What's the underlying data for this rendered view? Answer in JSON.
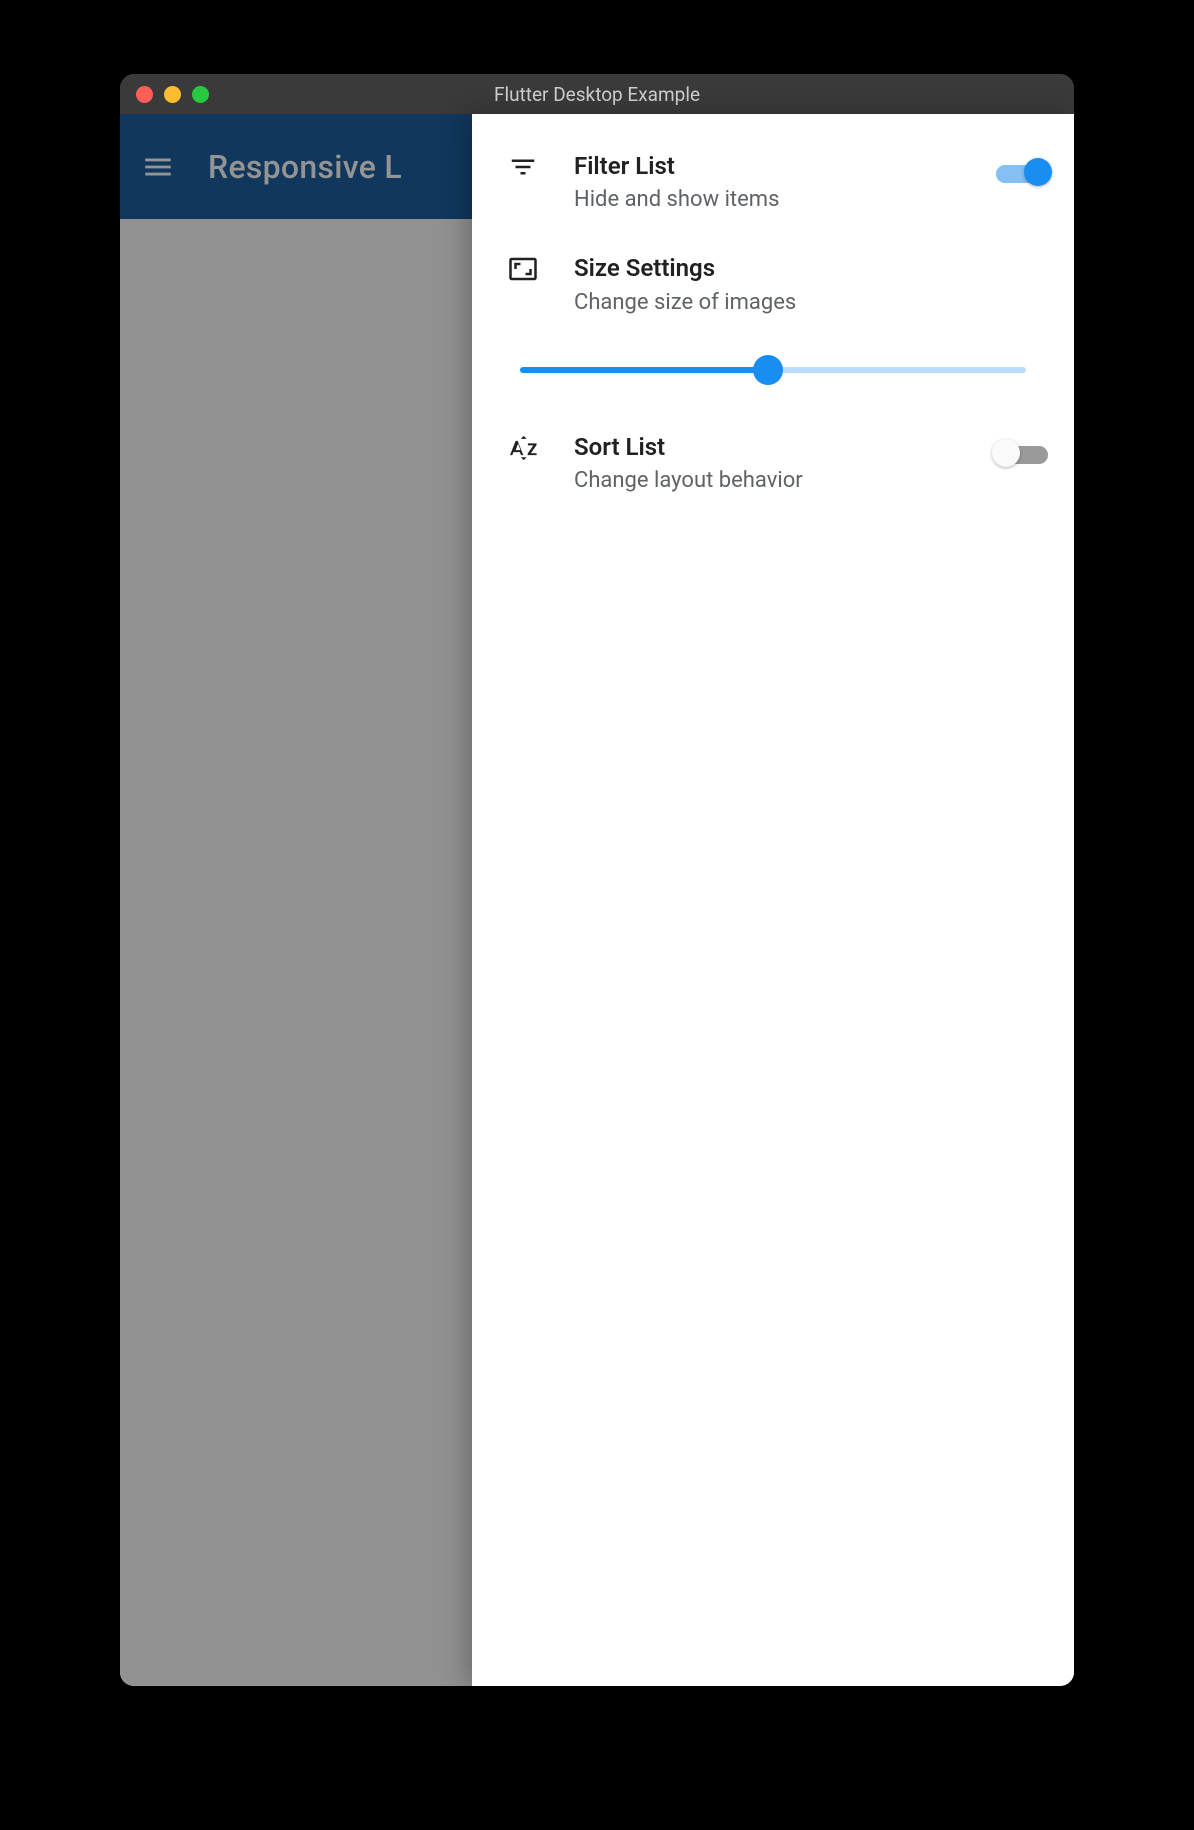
{
  "window": {
    "title": "Flutter Desktop Example"
  },
  "appbar": {
    "title": "Responsive L"
  },
  "drawer": {
    "filter": {
      "title": "Filter List",
      "subtitle": "Hide and show items",
      "enabled": true
    },
    "size": {
      "title": "Size Settings",
      "subtitle": "Change size of images",
      "slider_value": 0.49
    },
    "sort": {
      "title": "Sort List",
      "subtitle": "Change layout behavior",
      "enabled": false
    }
  },
  "colors": {
    "primary": "#1a8df0",
    "appbar": "#1e5fa0"
  }
}
